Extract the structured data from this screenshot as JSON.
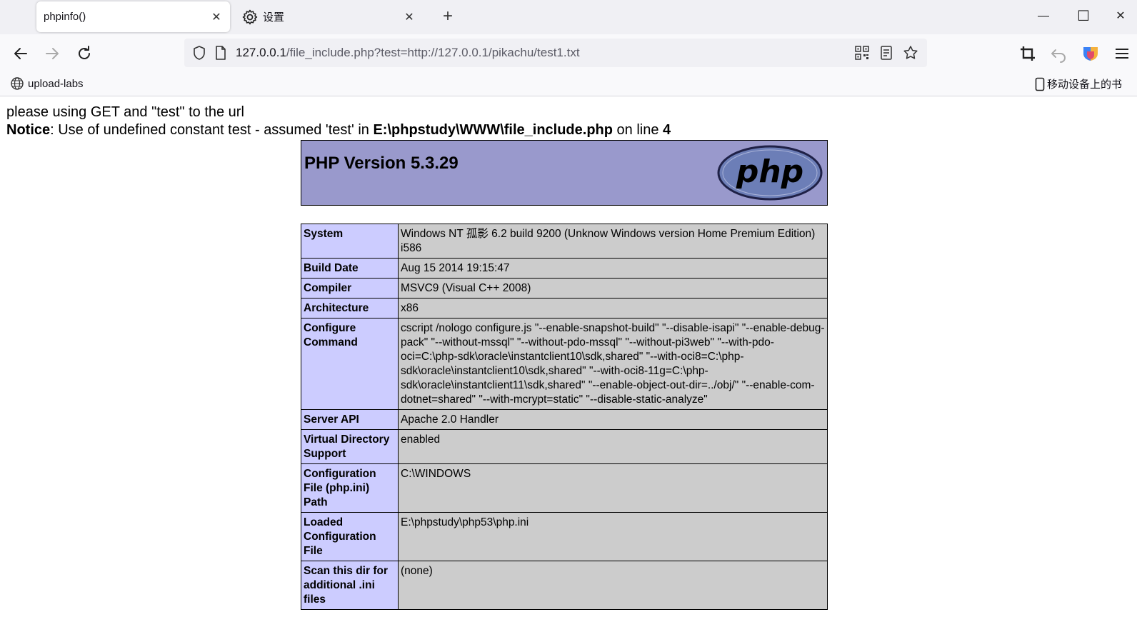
{
  "browser": {
    "tabs": [
      {
        "title": "phpinfo()",
        "active": true,
        "icon": "none"
      },
      {
        "title": "设置",
        "active": false,
        "icon": "gear-icon"
      }
    ],
    "tab_close_glyph": "✕",
    "new_tab_glyph": "+",
    "window_controls": {
      "minimize": "—",
      "maximize": "☐",
      "close": "✕"
    },
    "url": {
      "host": "127.0.0.1",
      "path": "/file_include.php?test=http://127.0.0.1/pikachu/test1.txt"
    },
    "bookmarks": [
      {
        "label": "upload-labs",
        "icon": "globe-icon"
      },
      {
        "label": "移动设备上的书",
        "icon": "mobile-icon"
      }
    ]
  },
  "page": {
    "line1": "please using GET and \"test\" to the url",
    "notice": {
      "label": "Notice",
      "text1": ": Use of undefined constant test - assumed 'test' in ",
      "file": "E:\\phpstudy\\WWW\\file_include.php",
      "text2": " on line ",
      "line": "4"
    },
    "php_version": "PHP Version 5.3.29",
    "logo_text": "php",
    "info_rows": [
      {
        "key": "System",
        "value": "Windows NT 孤影 6.2 build 9200 (Unknow Windows version Home Premium Edition) i586"
      },
      {
        "key": "Build Date",
        "value": "Aug 15 2014 19:15:47"
      },
      {
        "key": "Compiler",
        "value": "MSVC9 (Visual C++ 2008)"
      },
      {
        "key": "Architecture",
        "value": "x86"
      },
      {
        "key": "Configure Command",
        "value": "cscript /nologo configure.js \"--enable-snapshot-build\" \"--disable-isapi\" \"--enable-debug-pack\" \"--without-mssql\" \"--without-pdo-mssql\" \"--without-pi3web\" \"--with-pdo-oci=C:\\php-sdk\\oracle\\instantclient10\\sdk,shared\" \"--with-oci8=C:\\php-sdk\\oracle\\instantclient10\\sdk,shared\" \"--with-oci8-11g=C:\\php-sdk\\oracle\\instantclient11\\sdk,shared\" \"--enable-object-out-dir=../obj/\" \"--enable-com-dotnet=shared\" \"--with-mcrypt=static\" \"--disable-static-analyze\""
      },
      {
        "key": "Server API",
        "value": "Apache 2.0 Handler"
      },
      {
        "key": "Virtual Directory Support",
        "value": "enabled"
      },
      {
        "key": "Configuration File (php.ini) Path",
        "value": "C:\\WINDOWS"
      },
      {
        "key": "Loaded Configuration File",
        "value": "E:\\phpstudy\\php53\\php.ini"
      },
      {
        "key": "Scan this dir for additional .ini files",
        "value": "(none)"
      }
    ]
  },
  "colors": {
    "header_bg": "#9999cc",
    "key_bg": "#ccccff",
    "value_bg": "#cccccc",
    "logo_fill": "#6c7eb7"
  }
}
